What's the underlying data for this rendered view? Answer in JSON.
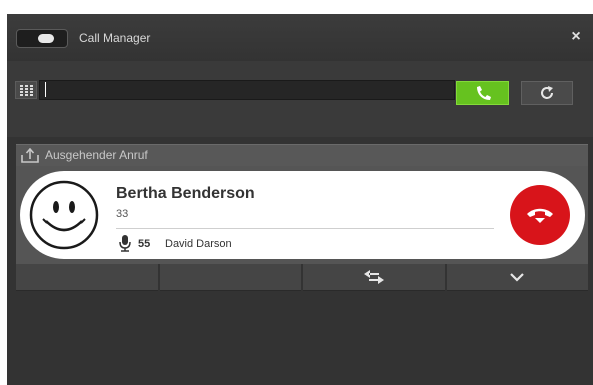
{
  "window": {
    "title": "Call Manager",
    "close_glyph": "×"
  },
  "dialbar": {
    "input_value": "",
    "input_placeholder": ""
  },
  "call": {
    "section_label": "Ausgehender Anruf",
    "caller_name": "Bertha Benderson",
    "caller_number": "33",
    "line_number": "55",
    "line_name": "David Darson"
  },
  "icons": {
    "toggle": "toggle-switch-icon",
    "keypad": "keypad-icon",
    "dial": "phone-call-icon",
    "refresh": "refresh-icon",
    "section": "outgoing-call-icon",
    "avatar": "smiley-icon",
    "microphone": "microphone-icon",
    "hangup": "hangup-icon",
    "transfer": "transfer-icon",
    "more": "chevron-down-icon"
  },
  "colors": {
    "call_green": "#66c21f",
    "hangup_red": "#d8141a",
    "panel_dark": "#333333"
  }
}
